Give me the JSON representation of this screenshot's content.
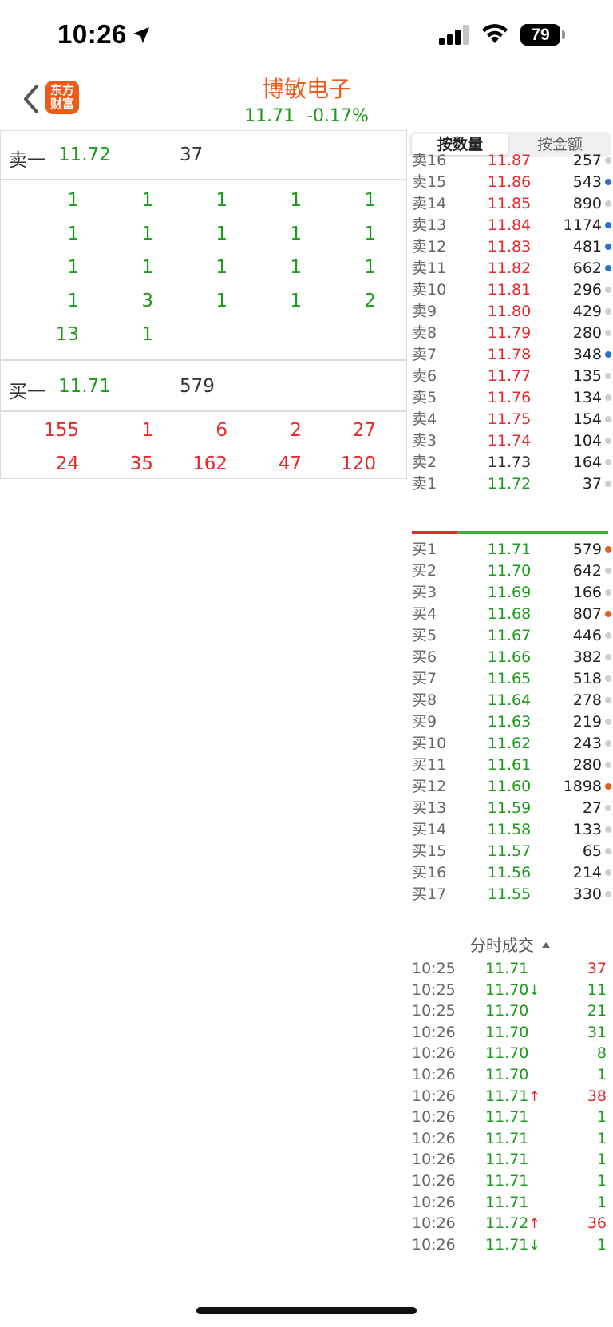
{
  "status_bar": {
    "time": "10:26",
    "battery": "79"
  },
  "header": {
    "app_logo_line1": "东方",
    "app_logo_line2": "财富",
    "stock_name": "博敏电子",
    "price": "11.71",
    "change": "-0.17%"
  },
  "left": {
    "sell1": {
      "label": "卖一",
      "price": "11.72",
      "volume": "37"
    },
    "sell_queue": [
      [
        "1",
        "1",
        "1",
        "1",
        "1"
      ],
      [
        "1",
        "1",
        "1",
        "1",
        "1"
      ],
      [
        "1",
        "1",
        "1",
        "1",
        "1"
      ],
      [
        "1",
        "3",
        "1",
        "1",
        "2"
      ],
      [
        "13",
        "1"
      ]
    ],
    "buy1": {
      "label": "买一",
      "price": "11.71",
      "volume": "579"
    },
    "buy_queue": [
      [
        "155",
        "1",
        "6",
        "2",
        "27"
      ],
      [
        "24",
        "35",
        "162",
        "47",
        "120"
      ]
    ]
  },
  "right": {
    "tabs": [
      "按数量",
      "按金额"
    ],
    "asks": [
      {
        "label": "卖16",
        "price": "11.87",
        "vol": "257",
        "dot": "gray",
        "color": "red"
      },
      {
        "label": "卖15",
        "price": "11.86",
        "vol": "543",
        "dot": "blue",
        "color": "red"
      },
      {
        "label": "卖14",
        "price": "11.85",
        "vol": "890",
        "dot": "gray",
        "color": "red"
      },
      {
        "label": "卖13",
        "price": "11.84",
        "vol": "1174",
        "dot": "blue",
        "color": "red"
      },
      {
        "label": "卖12",
        "price": "11.83",
        "vol": "481",
        "dot": "blue",
        "color": "red"
      },
      {
        "label": "卖11",
        "price": "11.82",
        "vol": "662",
        "dot": "blue",
        "color": "red"
      },
      {
        "label": "卖10",
        "price": "11.81",
        "vol": "296",
        "dot": "gray",
        "color": "red"
      },
      {
        "label": "卖9",
        "price": "11.80",
        "vol": "429",
        "dot": "gray",
        "color": "red"
      },
      {
        "label": "卖8",
        "price": "11.79",
        "vol": "280",
        "dot": "gray",
        "color": "red"
      },
      {
        "label": "卖7",
        "price": "11.78",
        "vol": "348",
        "dot": "blue",
        "color": "red"
      },
      {
        "label": "卖6",
        "price": "11.77",
        "vol": "135",
        "dot": "gray",
        "color": "red"
      },
      {
        "label": "卖5",
        "price": "11.76",
        "vol": "134",
        "dot": "gray",
        "color": "red"
      },
      {
        "label": "卖4",
        "price": "11.75",
        "vol": "154",
        "dot": "gray",
        "color": "red"
      },
      {
        "label": "卖3",
        "price": "11.74",
        "vol": "104",
        "dot": "gray",
        "color": "red"
      },
      {
        "label": "卖2",
        "price": "11.73",
        "vol": "164",
        "dot": "gray",
        "color": "dark"
      },
      {
        "label": "卖1",
        "price": "11.72",
        "vol": "37",
        "dot": "gray",
        "color": "green"
      }
    ],
    "bids": [
      {
        "label": "买1",
        "price": "11.71",
        "vol": "579",
        "dot": "orange"
      },
      {
        "label": "买2",
        "price": "11.70",
        "vol": "642",
        "dot": "gray"
      },
      {
        "label": "买3",
        "price": "11.69",
        "vol": "166",
        "dot": "gray"
      },
      {
        "label": "买4",
        "price": "11.68",
        "vol": "807",
        "dot": "orange"
      },
      {
        "label": "买5",
        "price": "11.67",
        "vol": "446",
        "dot": "gray"
      },
      {
        "label": "买6",
        "price": "11.66",
        "vol": "382",
        "dot": "gray"
      },
      {
        "label": "买7",
        "price": "11.65",
        "vol": "518",
        "dot": "gray"
      },
      {
        "label": "买8",
        "price": "11.64",
        "vol": "278",
        "dot": "gray"
      },
      {
        "label": "买9",
        "price": "11.63",
        "vol": "219",
        "dot": "gray"
      },
      {
        "label": "买10",
        "price": "11.62",
        "vol": "243",
        "dot": "gray"
      },
      {
        "label": "买11",
        "price": "11.61",
        "vol": "280",
        "dot": "gray"
      },
      {
        "label": "买12",
        "price": "11.60",
        "vol": "1898",
        "dot": "orange"
      },
      {
        "label": "买13",
        "price": "11.59",
        "vol": "27",
        "dot": "gray"
      },
      {
        "label": "买14",
        "price": "11.58",
        "vol": "133",
        "dot": "gray"
      },
      {
        "label": "买15",
        "price": "11.57",
        "vol": "65",
        "dot": "gray"
      },
      {
        "label": "买16",
        "price": "11.56",
        "vol": "214",
        "dot": "gray"
      },
      {
        "label": "买17",
        "price": "11.55",
        "vol": "330",
        "dot": "gray"
      }
    ],
    "trades_title": "分时成交",
    "trades": [
      {
        "time": "10:25",
        "price": "11.71",
        "arrow": "",
        "vol": "37",
        "color": "red"
      },
      {
        "time": "10:25",
        "price": "11.70",
        "arrow": "↓",
        "vol": "11",
        "color": "green"
      },
      {
        "time": "10:25",
        "price": "11.70",
        "arrow": "",
        "vol": "21",
        "color": "green"
      },
      {
        "time": "10:26",
        "price": "11.70",
        "arrow": "",
        "vol": "31",
        "color": "green"
      },
      {
        "time": "10:26",
        "price": "11.70",
        "arrow": "",
        "vol": "8",
        "color": "green"
      },
      {
        "time": "10:26",
        "price": "11.70",
        "arrow": "",
        "vol": "1",
        "color": "green"
      },
      {
        "time": "10:26",
        "price": "11.71",
        "arrow": "↑",
        "vol": "38",
        "color": "red"
      },
      {
        "time": "10:26",
        "price": "11.71",
        "arrow": "",
        "vol": "1",
        "color": "green"
      },
      {
        "time": "10:26",
        "price": "11.71",
        "arrow": "",
        "vol": "1",
        "color": "green"
      },
      {
        "time": "10:26",
        "price": "11.71",
        "arrow": "",
        "vol": "1",
        "color": "green"
      },
      {
        "time": "10:26",
        "price": "11.71",
        "arrow": "",
        "vol": "1",
        "color": "green"
      },
      {
        "time": "10:26",
        "price": "11.71",
        "arrow": "",
        "vol": "1",
        "color": "green"
      },
      {
        "time": "10:26",
        "price": "11.72",
        "arrow": "↑",
        "vol": "36",
        "color": "red"
      },
      {
        "time": "10:26",
        "price": "11.71",
        "arrow": "↓",
        "vol": "1",
        "color": "green"
      }
    ]
  },
  "colors": {
    "up": "#e8282b",
    "down": "#1a9c1a",
    "brand": "#f05a1a"
  }
}
